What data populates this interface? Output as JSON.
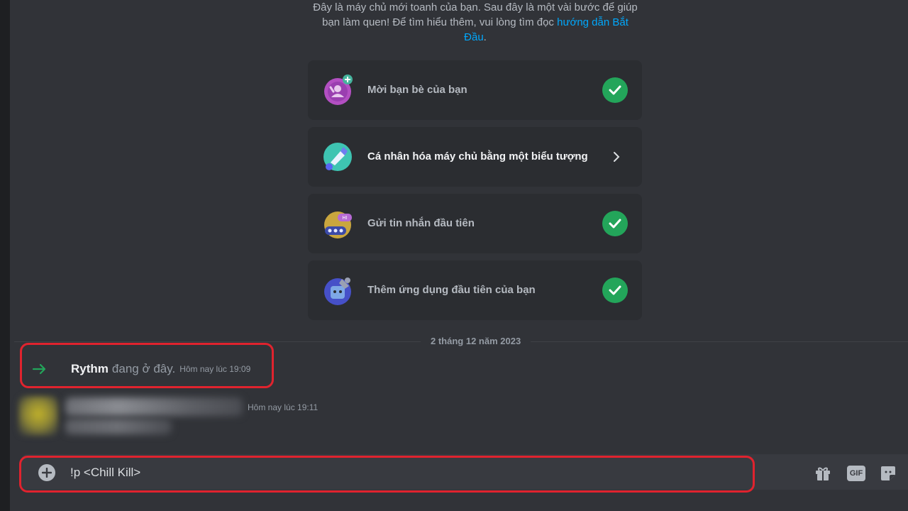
{
  "intro": {
    "line1": "Đây là máy chủ mới toanh của bạn. Sau đây là một vài bước để giúp",
    "line2_prefix": "bạn làm quen! Để tìm hiểu thêm, vui lòng tìm đọc",
    "link_part1": "hướng dẫn Bắt",
    "link_part2": "Đầu",
    "line3_suffix": "."
  },
  "checklist": [
    {
      "label": "Mời bạn bè của bạn",
      "icon": "invite-friends-icon",
      "status": "done"
    },
    {
      "label": "Cá nhân hóa máy chủ bằng một biểu tượng",
      "icon": "paintbrush-icon",
      "status": "pending"
    },
    {
      "label": "Gửi tin nhắn đầu tiên",
      "icon": "chat-bubble-icon",
      "status": "done"
    },
    {
      "label": "Thêm ứng dụng đầu tiên của bạn",
      "icon": "wrench-app-icon",
      "status": "done"
    }
  ],
  "divider_date": "2 tháng 12 năm 2023",
  "join_message": {
    "name": "Rythm",
    "text": "đang ở đây.",
    "time": "Hôm nay lúc 19:09"
  },
  "blurred_message": {
    "time": "Hôm nay lúc 19:11"
  },
  "composer": {
    "value": "!p <Chill Kill>",
    "gif_label": "GIF"
  },
  "colors": {
    "background": "#313338",
    "card": "#2b2d31",
    "check": "#23a55a",
    "link": "#00a8fc",
    "highlight": "#e0232e"
  }
}
